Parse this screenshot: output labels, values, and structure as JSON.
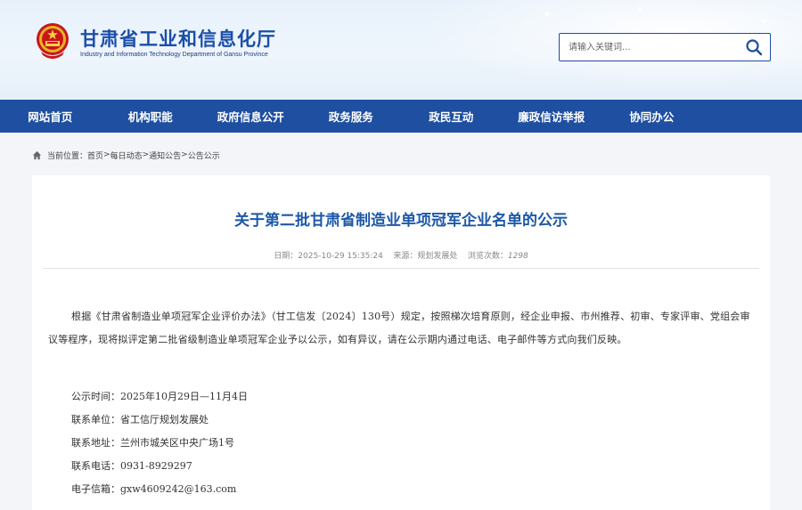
{
  "header": {
    "title": "甘肃省工业和信息化厅",
    "subtitle": "Industry and Information Technology Department of Gansu Province",
    "search_placeholder": "请输入关键词..."
  },
  "nav": {
    "items": [
      "网站首页",
      "机构职能",
      "政府信息公开",
      "政务服务",
      "政民互动",
      "廉政信访举报",
      "协同办公"
    ]
  },
  "breadcrumb": {
    "label": "当前位置：",
    "items": [
      "首页",
      "每日动态",
      "通知公告",
      "公告公示"
    ],
    "separator": ">"
  },
  "article": {
    "title": "关于第二批甘肃省制造业单项冠军企业名单的公示",
    "date_label": "日期：",
    "date": "2025-10-29 15:35:24",
    "source_label": "来源：",
    "source": "规划发展处",
    "hits_label": "浏览次数：",
    "hits": "1298",
    "body": "根据《甘肃省制造业单项冠军企业评价办法》（甘工信发〔2024〕130号）规定，按照梯次培育原则，经企业申报、市州推荐、初审、专家评审、党组会审议等程序，现将拟评定第二批省级制造业单项冠军企业予以公示，如有异议，请在公示期内通过电话、电子邮件等方式向我们反映。",
    "info": [
      "公示时间：2025年10月29日—11月4日",
      "联系单位：省工信厅规划发展处",
      "联系地址：兰州市城关区中央广场1号",
      "联系电话：0931-8929297",
      "电子信箱：gxw4609242@163.com"
    ]
  },
  "colors": {
    "brand": "#1f4fa0",
    "title": "#1d58a8"
  }
}
